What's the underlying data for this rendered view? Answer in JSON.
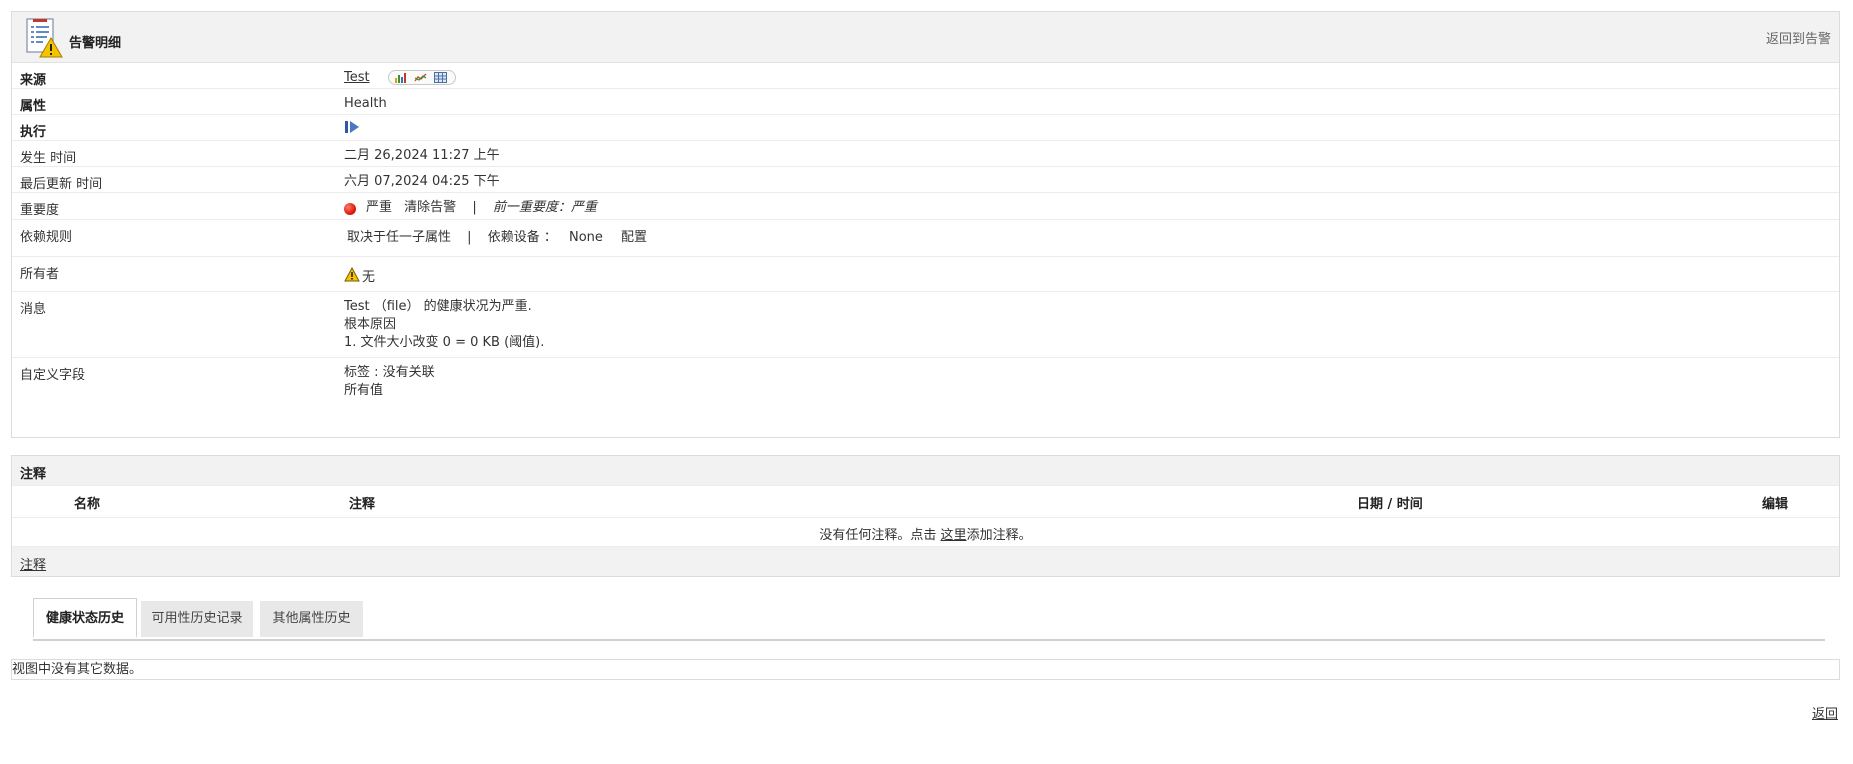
{
  "header": {
    "title": "告警明细",
    "back_link": "返回到告警",
    "icon": "alarm-report-icon"
  },
  "details": {
    "source": {
      "label": "来源",
      "value": "Test",
      "icons": [
        "bar-chart-icon",
        "line-chart-icon",
        "table-icon"
      ]
    },
    "attribute": {
      "label": "属性",
      "value": "Health"
    },
    "execute": {
      "label": "执行",
      "icon": "execute-action-icon"
    },
    "occurred_time": {
      "label": "发生 时间",
      "value": "二月 26,2024 11:27 上午"
    },
    "last_update_time": {
      "label": "最后更新 时间",
      "value": "六月 07,2024 04:25 下午"
    },
    "severity": {
      "label": "重要度",
      "value": "严重",
      "clear_link": "清除告警",
      "separator": "|",
      "previous": "前一重要度：严重",
      "color": "#e01b0b"
    },
    "dependency": {
      "label": "依赖规则",
      "rule": "取决于任一子属性",
      "separator": "|",
      "device_label": "依赖设备 ：",
      "device_value": "None",
      "configure_link": "配置"
    },
    "owner": {
      "label": "所有者",
      "value": "无",
      "icon": "warning-icon"
    },
    "message": {
      "label": "消息",
      "lines": [
        "Test （file） 的健康状况为严重.",
        "根本原因",
        "1. 文件大小改变 0 = 0 KB (阈值)."
      ]
    },
    "custom_fields": {
      "label": "自定义字段",
      "lines": [
        "标签 : 没有关联",
        "所有值"
      ]
    }
  },
  "notes": {
    "title": "注释",
    "columns": [
      "名称",
      "注释",
      "日期 / 时间",
      "编辑"
    ],
    "empty_prefix": "没有任何注释。点击 ",
    "empty_link": "这里",
    "empty_suffix": "添加注释。",
    "footer_link": "注释"
  },
  "tabs": [
    {
      "label": "健康状态历史",
      "active": true
    },
    {
      "label": "可用性历史记录",
      "active": false
    },
    {
      "label": "其他属性历史",
      "active": false
    }
  ],
  "no_data": "视图中没有其它数据。",
  "bottom_back": "返回"
}
